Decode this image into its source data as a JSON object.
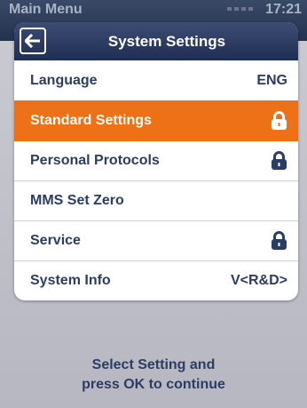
{
  "background_screen": {
    "title": "Main Menu",
    "clock": "17:21"
  },
  "header": {
    "back_icon": "arrow-left-icon",
    "title": "System Settings"
  },
  "menu": {
    "items": [
      {
        "label": "Language",
        "value": "ENG",
        "locked": false,
        "selected": false
      },
      {
        "label": "Standard Settings",
        "value": "",
        "locked": true,
        "selected": true,
        "icon": "lock-icon"
      },
      {
        "label": "Personal Protocols",
        "value": "",
        "locked": true,
        "selected": false,
        "icon": "lock-icon"
      },
      {
        "label": "MMS Set Zero",
        "value": "",
        "locked": false,
        "selected": false
      },
      {
        "label": "Service",
        "value": "",
        "locked": true,
        "selected": false,
        "icon": "lock-icon"
      },
      {
        "label": "System Info",
        "value": "V<R&D>",
        "locked": false,
        "selected": false
      }
    ]
  },
  "footer": {
    "line1": "Select Setting and",
    "line2": "press OK to continue"
  },
  "colors": {
    "header_bg": "#26355a",
    "selected_bg": "#ee7118",
    "text_primary": "#2c3d63",
    "page_bg": "#bdbdc7"
  }
}
